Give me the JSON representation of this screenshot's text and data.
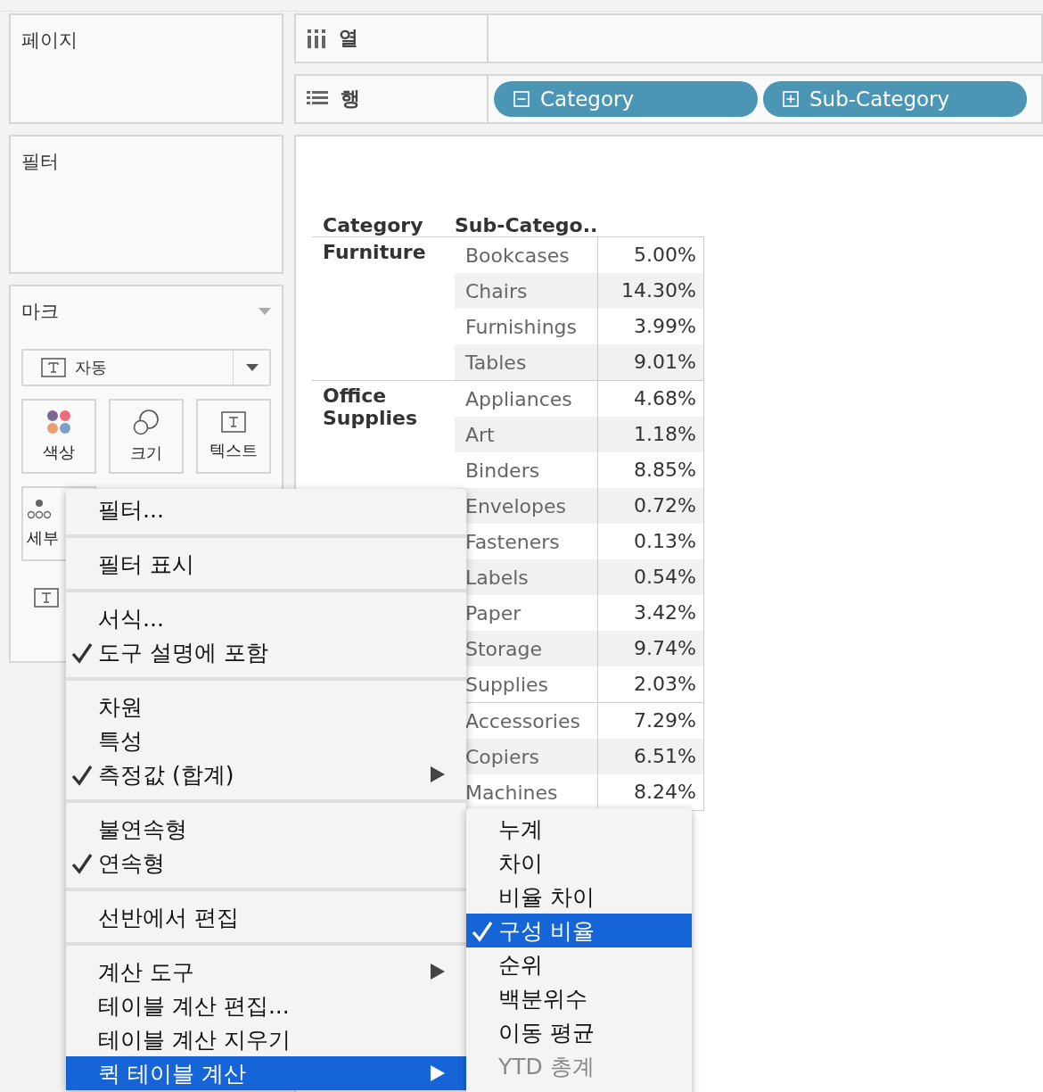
{
  "pages_card": {
    "title": "페이지"
  },
  "filters_card": {
    "title": "필터"
  },
  "marks_card": {
    "title": "마크",
    "mark_type": "자동",
    "buttons": [
      {
        "kind": "color",
        "label": "색상"
      },
      {
        "kind": "size",
        "label": "크기"
      },
      {
        "kind": "text",
        "label": "텍스트"
      },
      {
        "kind": "detail",
        "label": "세부"
      }
    ]
  },
  "shelves": {
    "columns": {
      "label": "열"
    },
    "rows": {
      "label": "행",
      "pills": [
        {
          "label": "Category",
          "expanded": true
        },
        {
          "label": "Sub-Category",
          "expanded": false
        }
      ]
    }
  },
  "table": {
    "columns": [
      "Category",
      "Sub-Catego.."
    ],
    "groups": [
      {
        "category": "Furniture",
        "rows": [
          {
            "sub_category": "Bookcases",
            "value": "5.00%"
          },
          {
            "sub_category": "Chairs",
            "value": "14.30%"
          },
          {
            "sub_category": "Furnishings",
            "value": "3.99%"
          },
          {
            "sub_category": "Tables",
            "value": "9.01%"
          }
        ]
      },
      {
        "category": "Office Supplies",
        "rows": [
          {
            "sub_category": "Appliances",
            "value": "4.68%"
          },
          {
            "sub_category": "Art",
            "value": "1.18%"
          },
          {
            "sub_category": "Binders",
            "value": "8.85%"
          },
          {
            "sub_category": "Envelopes",
            "value": "0.72%"
          },
          {
            "sub_category": "Fasteners",
            "value": "0.13%"
          },
          {
            "sub_category": "Labels",
            "value": "0.54%"
          },
          {
            "sub_category": "Paper",
            "value": "3.42%"
          },
          {
            "sub_category": "Storage",
            "value": "9.74%"
          },
          {
            "sub_category": "Supplies",
            "value": "2.03%"
          }
        ]
      },
      {
        "rows": [
          {
            "sub_category": "Accessories",
            "value": "7.29%"
          },
          {
            "sub_category": "Copiers",
            "value": "6.51%"
          },
          {
            "sub_category": "Machines",
            "value": "8.24%"
          }
        ]
      }
    ]
  },
  "context_menu": {
    "items": [
      {
        "kind": "item",
        "label": "필터...",
        "checked": false,
        "submenu": false,
        "selected": false
      },
      {
        "kind": "separator"
      },
      {
        "kind": "item",
        "label": "필터 표시",
        "checked": false,
        "submenu": false,
        "selected": false
      },
      {
        "kind": "separator"
      },
      {
        "kind": "item",
        "label": "서식...",
        "checked": false,
        "submenu": false,
        "selected": false
      },
      {
        "kind": "item",
        "label": "도구 설명에 포함",
        "checked": true,
        "submenu": false,
        "selected": false
      },
      {
        "kind": "separator"
      },
      {
        "kind": "item",
        "label": "차원",
        "checked": false,
        "submenu": false,
        "selected": false
      },
      {
        "kind": "item",
        "label": "특성",
        "checked": false,
        "submenu": false,
        "selected": false
      },
      {
        "kind": "item",
        "label": "측정값 (합계)",
        "checked": true,
        "submenu": true,
        "selected": false
      },
      {
        "kind": "separator"
      },
      {
        "kind": "item",
        "label": "불연속형",
        "checked": false,
        "submenu": false,
        "selected": false
      },
      {
        "kind": "item",
        "label": "연속형",
        "checked": true,
        "submenu": false,
        "selected": false
      },
      {
        "kind": "separator"
      },
      {
        "kind": "item",
        "label": "선반에서 편집",
        "checked": false,
        "submenu": false,
        "selected": false
      },
      {
        "kind": "separator"
      },
      {
        "kind": "item",
        "label": "계산 도구",
        "checked": false,
        "submenu": true,
        "selected": false
      },
      {
        "kind": "item",
        "label": "테이블 계산 편집...",
        "checked": false,
        "submenu": false,
        "selected": false
      },
      {
        "kind": "item",
        "label": "테이블 계산 지우기",
        "checked": false,
        "submenu": false,
        "selected": false
      },
      {
        "kind": "item",
        "label": "퀵 테이블 계산",
        "checked": false,
        "submenu": true,
        "selected": true
      }
    ]
  },
  "submenu": {
    "items": [
      {
        "label": "누계",
        "checked": false,
        "selected": false,
        "disabled": false
      },
      {
        "label": "차이",
        "checked": false,
        "selected": false,
        "disabled": false
      },
      {
        "label": "비율 차이",
        "checked": false,
        "selected": false,
        "disabled": false
      },
      {
        "label": "구성 비율",
        "checked": true,
        "selected": true,
        "disabled": false
      },
      {
        "label": "순위",
        "checked": false,
        "selected": false,
        "disabled": false
      },
      {
        "label": "백분위수",
        "checked": false,
        "selected": false,
        "disabled": false
      },
      {
        "label": "이동 평균",
        "checked": false,
        "selected": false,
        "disabled": false
      },
      {
        "label": "YTD 총계",
        "checked": false,
        "selected": false,
        "disabled": true
      }
    ]
  }
}
